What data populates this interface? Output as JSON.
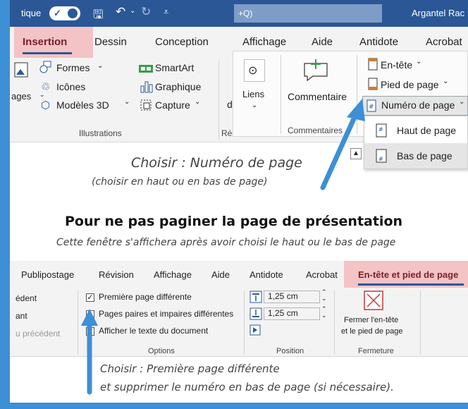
{
  "titlebar": {
    "autosave_text": "tique",
    "search_text": "+Q)",
    "user_name": "Argantel Rac"
  },
  "ribbon1": {
    "tabs": [
      "Insertion",
      "Dessin",
      "Conception",
      "Affichage",
      "Aide",
      "Antidote",
      "Acrobat"
    ],
    "illustrations": {
      "images_label": "ages",
      "formes": "Formes",
      "icones": "Icônes",
      "modeles3d": "Modèles 3D",
      "smartart": "SmartArt",
      "graphique": "Graphique",
      "capture": "Capture",
      "group_label": "Illustrations"
    },
    "liens": {
      "label": "Liens",
      "partial_d": "d",
      "partial_group": "Réı"
    },
    "commentaire": {
      "label": "Commentaire",
      "group_label": "Commentaires"
    },
    "entete": {
      "entete": "En-tête",
      "pied_de_page": "Pied de page",
      "numero_de_page": "Numéro de page"
    },
    "dropdown": [
      "Haut de page",
      "Bas de page"
    ]
  },
  "captions": {
    "caption1_main": "Choisir : Numéro de page",
    "caption1_sub": "(choisir en haut ou en bas de page)",
    "heading": "Pour ne pas paginer la page de présentation",
    "subheading": "Cette fenêtre s'affichera après avoir choisi le haut ou le bas de page",
    "caption2_line1": "Choisir : Première page différente",
    "caption2_line2": "et supprimer le numéro en bas de page (si nécessaire)."
  },
  "ribbon2": {
    "tabs": [
      "Publipostage",
      "Révision",
      "Affichage",
      "Aide",
      "Antidote",
      "Acrobat",
      "En-tête et pied de page"
    ],
    "nav": [
      "édent",
      "ant",
      "u précédent"
    ],
    "options": {
      "premiere_page": "Première page différente",
      "paires_impaires": "Pages paires et impaires différentes",
      "afficher_texte": "Afficher le texte du document",
      "group_label": "Options",
      "premiere_checked": true,
      "paires_checked": false,
      "afficher_checked": true
    },
    "position": {
      "top_value": "1,25 cm",
      "bottom_value": "1,25 cm",
      "group_label": "Position"
    },
    "fermeture": {
      "line1": "Fermer l'en-tête",
      "line2": "et le pied de page",
      "group_label": "Fermeture"
    }
  },
  "colors": {
    "accent_blue": "#3d8fd6",
    "tab_highlight": "#f4c3c5",
    "active_underline": "#2b5797",
    "close_red": "#d13438"
  }
}
